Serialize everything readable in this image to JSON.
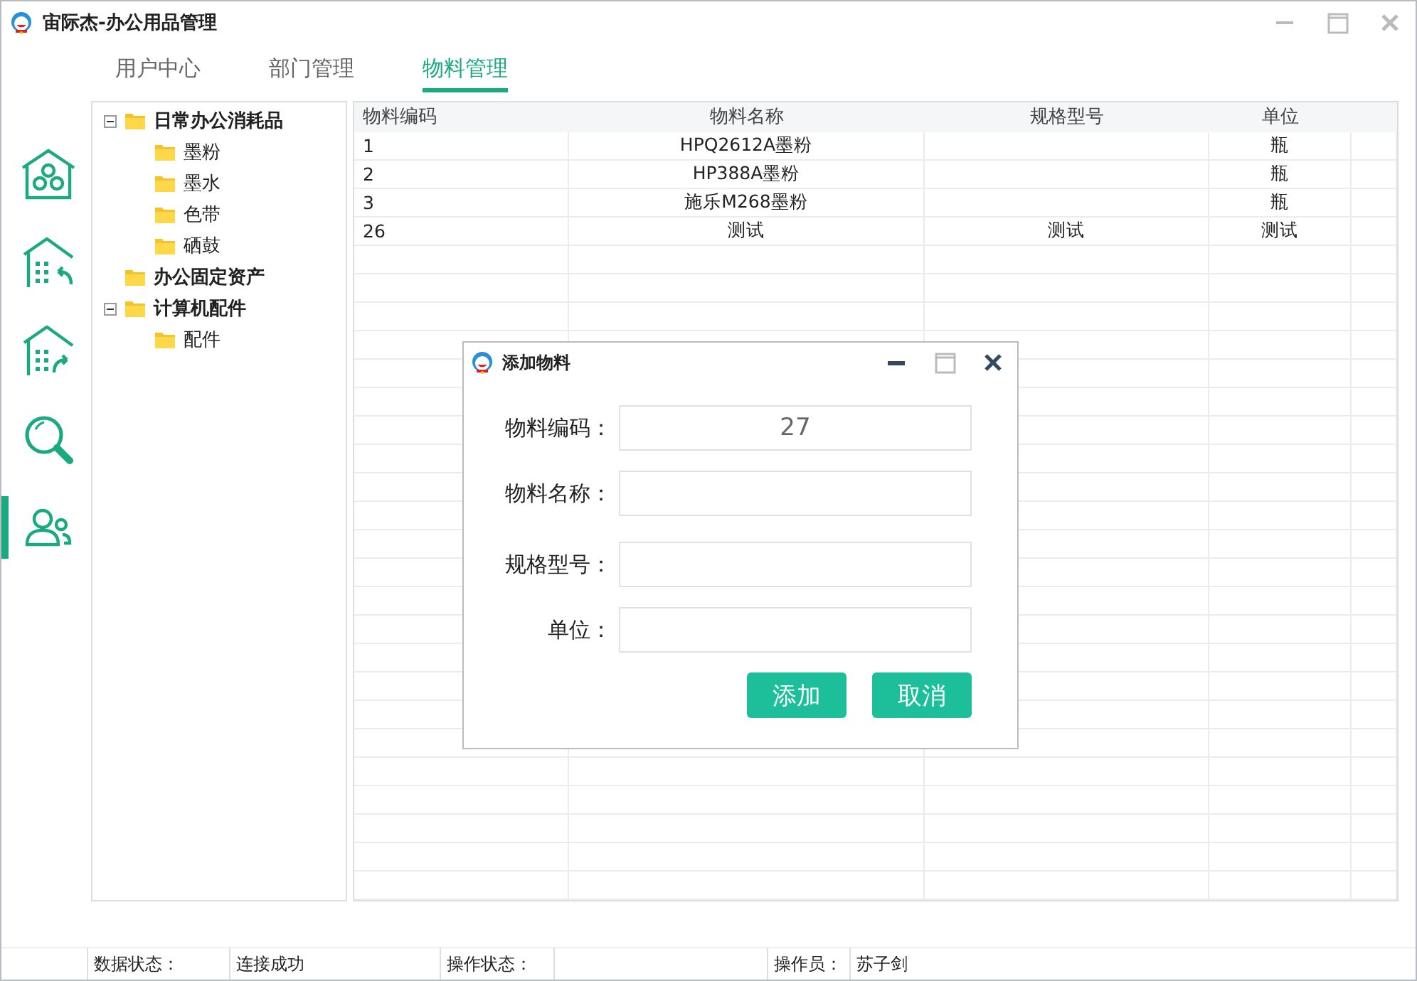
{
  "window": {
    "title": "宙际杰-办公用品管理"
  },
  "tabs": [
    {
      "label": "用户中心",
      "selected": false
    },
    {
      "label": "部门管理",
      "selected": false
    },
    {
      "label": "物料管理",
      "selected": true
    }
  ],
  "sidebar": {
    "items": [
      {
        "kind": "home",
        "selected": false
      },
      {
        "kind": "import",
        "selected": false
      },
      {
        "kind": "export",
        "selected": false
      },
      {
        "kind": "search",
        "selected": false
      },
      {
        "kind": "users",
        "selected": true
      }
    ]
  },
  "tree": [
    {
      "label": "日常办公消耗品",
      "expanded": true,
      "children": [
        {
          "label": "墨粉"
        },
        {
          "label": "墨水"
        },
        {
          "label": "色带"
        },
        {
          "label": "硒鼓"
        }
      ]
    },
    {
      "label": "办公固定资产"
    },
    {
      "label": "计算机配件",
      "expanded": true,
      "children": [
        {
          "label": "配件"
        }
      ]
    }
  ],
  "table": {
    "columns": [
      "物料编码",
      "物料名称",
      "规格型号",
      "单位"
    ],
    "rows": [
      [
        "1",
        "HPQ2612A墨粉",
        "",
        "瓶"
      ],
      [
        "2",
        "HP388A墨粉",
        "",
        "瓶"
      ],
      [
        "3",
        "施乐M268墨粉",
        "",
        "瓶"
      ],
      [
        "26",
        "测试",
        "测试",
        "测试"
      ]
    ]
  },
  "dialog": {
    "title": "添加物料",
    "fields": [
      {
        "label": "物料编码：",
        "value": "27"
      },
      {
        "label": "物料名称："
      },
      {
        "label": "规格型号："
      },
      {
        "label": "单位："
      }
    ],
    "buttons": [
      "添加",
      "取消"
    ]
  },
  "status_bar": [
    {
      "label": "数据状态：",
      "value": "连接成功"
    },
    {
      "label": "操作状态："
    },
    {
      "label": "操作员：",
      "value": "苏子剑"
    }
  ]
}
